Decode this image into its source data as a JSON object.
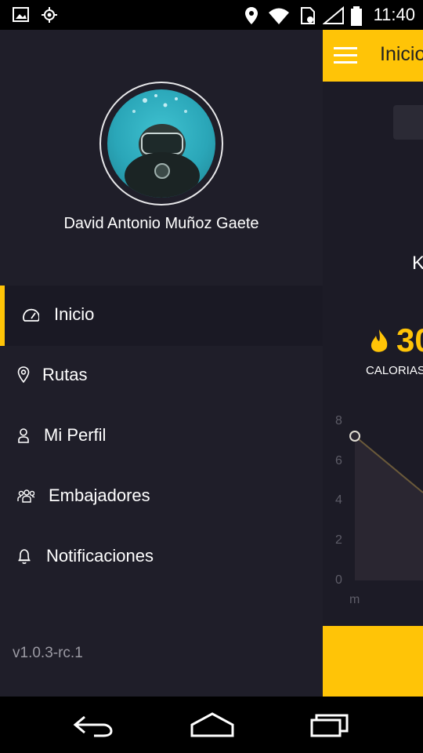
{
  "status_bar": {
    "time": "11:40"
  },
  "drawer": {
    "user_name": "David Antonio Muñoz Gaete",
    "items": [
      {
        "label": "Inicio",
        "icon": "speedometer-icon",
        "active": true
      },
      {
        "label": "Rutas",
        "icon": "map-pin-icon"
      },
      {
        "label": "Mi Perfil",
        "icon": "person-icon"
      },
      {
        "label": "Embajadores",
        "icon": "group-icon"
      },
      {
        "label": "Notificaciones",
        "icon": "bell-icon"
      }
    ],
    "version": "v1.0.3-rc.1"
  },
  "main": {
    "title": "Inicio",
    "km_partial": "K",
    "calories_value": "30",
    "calories_label": "CALORIAS",
    "chart_y_ticks": [
      "8",
      "6",
      "4",
      "2",
      "0"
    ],
    "chart_x_unit": "m"
  },
  "colors": {
    "accent": "#ffc407",
    "drawer_bg": "#1f1e29"
  }
}
